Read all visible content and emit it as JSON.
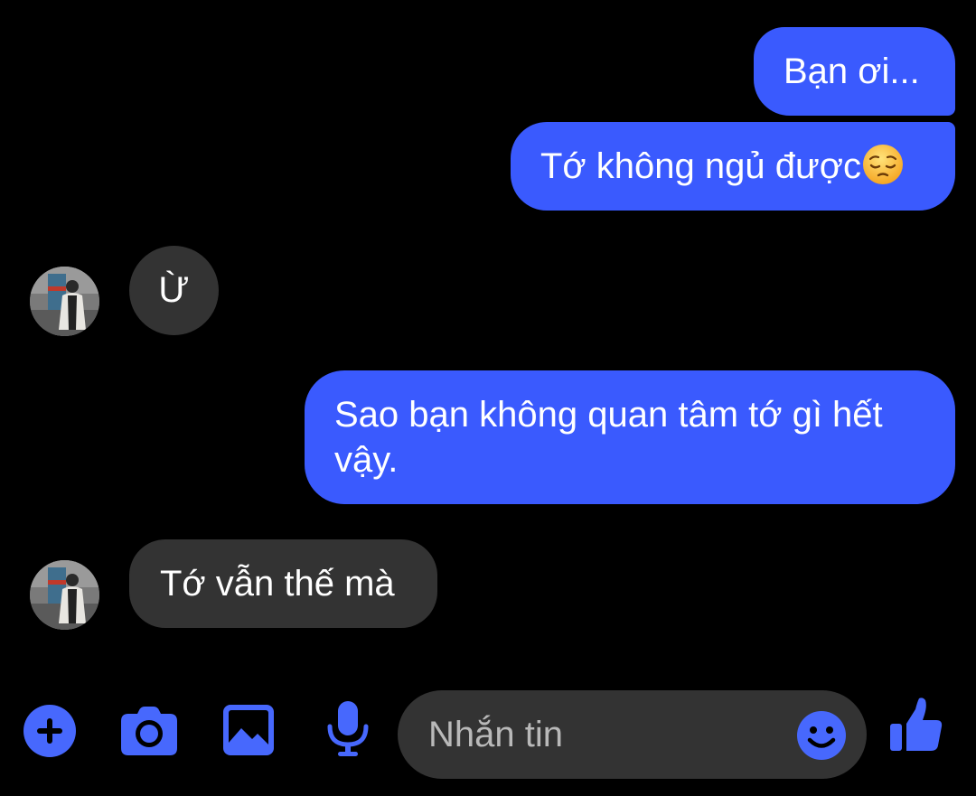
{
  "conversation": {
    "messages": [
      {
        "sender": "me",
        "text": "Bạn ơi..."
      },
      {
        "sender": "me",
        "text": "Tớ không ngủ được",
        "emoji": "pensive-face"
      },
      {
        "sender": "friend",
        "text": "Ừ"
      },
      {
        "sender": "me",
        "text": "Sao bạn không quan tâm tớ gì hết vậy."
      },
      {
        "sender": "friend",
        "text": "Tớ vẫn thế mà"
      }
    ]
  },
  "composer": {
    "placeholder": "Nhắn tin",
    "value": ""
  },
  "toolbar": {
    "icons": [
      "plus-icon",
      "camera-icon",
      "image-icon",
      "microphone-icon",
      "thumbs-up-icon"
    ]
  },
  "colors": {
    "outgoing_bubble": "#3a5afe",
    "incoming_bubble": "#333333",
    "accent": "#4768fd",
    "background": "#000000"
  }
}
